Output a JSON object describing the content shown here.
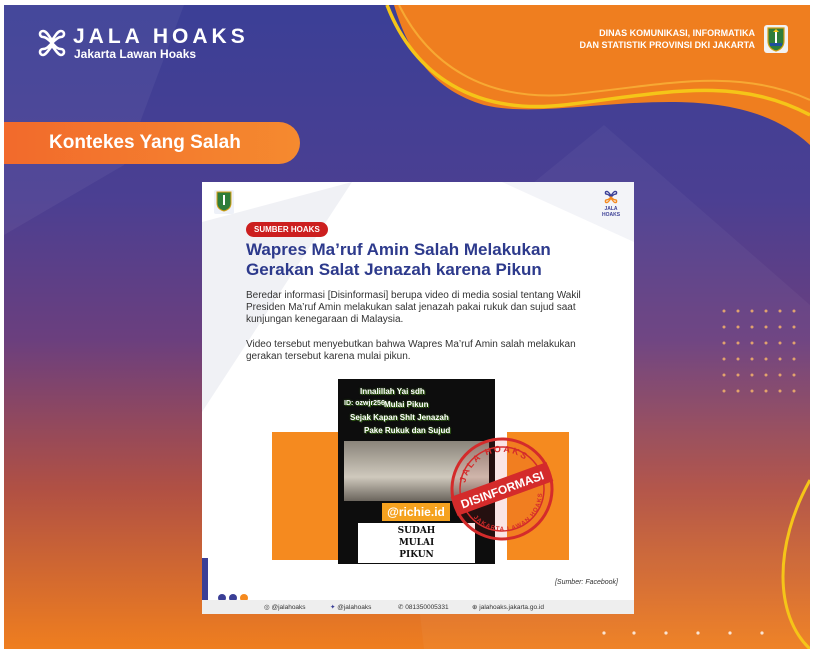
{
  "header": {
    "logo_name": "JALA HOAKS",
    "logo_tagline": "Jakarta Lawan Hoaks",
    "agency_line1": "DINAS KOMUNIKASI, INFORMATIKA",
    "agency_line2": "DAN STATISTIK PROVINSI DKI JAKARTA",
    "logo_icon": "jala-hoaks-logo-icon",
    "emblem_icon": "dki-jakarta-emblem-icon"
  },
  "category_label": "Kontekes Yang Salah",
  "card": {
    "badge": "SUMBER HOAKS",
    "title_line1": "Wapres Ma’ruf Amin Salah Melakukan",
    "title_line2": "Gerakan Salat Jenazah karena Pikun",
    "paragraph1": "Beredar informasi [Disinformasi] berupa video di media sosial tentang Wakil Presiden Ma’ruf Amin melakukan salat jenazah pakai rukuk dan sujud saat kunjungan kenegaraan di Malaysia.",
    "paragraph2": "Video tersebut menyebutkan bahwa Wapres Ma’ruf Amin salah melakukan gerakan tersebut karena mulai pikun.",
    "mini_logo_text": "JALA HOAKS",
    "video": {
      "line1": "Innalillah Yai sdh",
      "line2_id": "ID: ozwjr256",
      "line2": "Mulai Pikun",
      "line3": "Sejak Kapan Shlt Jenazah",
      "line4": "Pake Rukuk dan Sujud",
      "overlay_tag": "@richie.id",
      "caption_line1": "SUDAH",
      "caption_line2": "MULAI",
      "caption_line3": "PIKUN"
    },
    "stamp": {
      "text": "DISINFORMASI",
      "arc_top": "JALA HOAKS",
      "arc_bottom": "JAKARTA LAWAN HOAKS"
    },
    "source": "[Sumber: Facebook]",
    "footer": {
      "instagram": "@jalahoaks",
      "twitter": "@jalahoaks",
      "whatsapp": "081350005331",
      "website": "jalahoaks.jakarta.go.id"
    }
  },
  "colors": {
    "navy": "#3b3f96",
    "orange": "#f58a1f",
    "badge_red": "#cc1f1f",
    "title_blue": "#2d3a8c",
    "stamp_red": "#d42b2b",
    "gold": "#f5c518"
  }
}
